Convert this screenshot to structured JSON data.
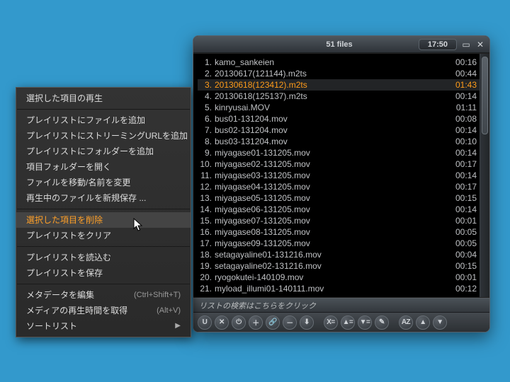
{
  "player": {
    "title": "51 files",
    "clock": "17:50",
    "search_placeholder": "リストの検索はこちらをクリック",
    "toolbar_icons": [
      "magnet",
      "shuffle",
      "power",
      "plus",
      "link",
      "minus",
      "down",
      "xeq",
      "asc-up",
      "desc-down",
      "edit",
      "az",
      "up",
      "dn"
    ],
    "toolbar_glyphs": {
      "magnet": "U",
      "shuffle": "✕",
      "power": "⏻",
      "plus": "＋",
      "link": "🔗",
      "minus": "－",
      "down": "⬇",
      "xeq": "X=",
      "asc-up": "▲=",
      "desc-down": "▼=",
      "edit": "✎",
      "az": "AZ",
      "up": "▲",
      "dn": "▼"
    },
    "items": [
      {
        "n": 1,
        "name": "kamo_sankeien",
        "dur": "00:16"
      },
      {
        "n": 2,
        "name": "20130617(121144).m2ts",
        "dur": "00:44"
      },
      {
        "n": 3,
        "name": "20130618(123412).m2ts",
        "dur": "01:43",
        "sel": true
      },
      {
        "n": 4,
        "name": "20130618(125137).m2ts",
        "dur": "00:14"
      },
      {
        "n": 5,
        "name": "kinryusai.MOV",
        "dur": "01:11"
      },
      {
        "n": 6,
        "name": "bus01-131204.mov",
        "dur": "00:08"
      },
      {
        "n": 7,
        "name": "bus02-131204.mov",
        "dur": "00:14"
      },
      {
        "n": 8,
        "name": "bus03-131204.mov",
        "dur": "00:10"
      },
      {
        "n": 9,
        "name": "miyagase01-131205.mov",
        "dur": "00:14"
      },
      {
        "n": 10,
        "name": "miyagase02-131205.mov",
        "dur": "00:17"
      },
      {
        "n": 11,
        "name": "miyagase03-131205.mov",
        "dur": "00:14"
      },
      {
        "n": 12,
        "name": "miyagase04-131205.mov",
        "dur": "00:17"
      },
      {
        "n": 13,
        "name": "miyagase05-131205.mov",
        "dur": "00:15"
      },
      {
        "n": 14,
        "name": "miyagase06-131205.mov",
        "dur": "00:14"
      },
      {
        "n": 15,
        "name": "miyagase07-131205.mov",
        "dur": "00:01"
      },
      {
        "n": 16,
        "name": "miyagase08-131205.mov",
        "dur": "00:05"
      },
      {
        "n": 17,
        "name": "miyagase09-131205.mov",
        "dur": "00:05"
      },
      {
        "n": 18,
        "name": "setagayaline01-131216.mov",
        "dur": "00:04"
      },
      {
        "n": 19,
        "name": "setagayaline02-131216.mov",
        "dur": "00:15"
      },
      {
        "n": 20,
        "name": "ryogokutei-140109.mov",
        "dur": "00:01"
      },
      {
        "n": 21,
        "name": "myload_illumi01-140111.mov",
        "dur": "00:12"
      }
    ]
  },
  "menu": {
    "items": [
      {
        "label": "選択した項目の再生"
      },
      {
        "sep": true
      },
      {
        "label": "プレイリストにファイルを追加"
      },
      {
        "label": "プレイリストにストリーミングURLを追加"
      },
      {
        "label": "プレイリストにフォルダーを追加"
      },
      {
        "label": "項目フォルダーを開く"
      },
      {
        "label": "ファイルを移動/名前を変更"
      },
      {
        "label": "再生中のファイルを新規保存 ..."
      },
      {
        "sep": true
      },
      {
        "label": "選択した項目を削除",
        "hl": true
      },
      {
        "label": "プレイリストをクリア"
      },
      {
        "sep": true
      },
      {
        "label": "プレイリストを読込む"
      },
      {
        "label": "プレイリストを保存"
      },
      {
        "sep": true
      },
      {
        "label": "メタデータを編集",
        "shortcut": "(Ctrl+Shift+T)"
      },
      {
        "label": "メディアの再生時間を取得",
        "shortcut": "(Alt+V)"
      },
      {
        "label": "ソートリスト",
        "arrow": true
      }
    ]
  }
}
